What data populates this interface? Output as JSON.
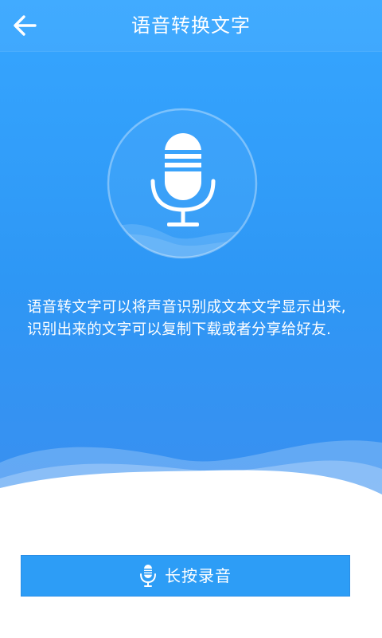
{
  "header": {
    "title": "语音转换文字",
    "back_icon": "arrow-left-icon"
  },
  "main": {
    "illustration_icon": "microphone-icon",
    "description": "语音转文字可以将声音识别成文本文字显示出来,识别出来的文字可以复制下载或者分享给好友."
  },
  "footer": {
    "button_label": "长按录音",
    "button_icon": "microphone-icon"
  },
  "colors": {
    "primary": "#2d9df6",
    "background_top": "#36a6ff",
    "text_on_primary": "#ffffff",
    "page_background": "#ffffff"
  }
}
